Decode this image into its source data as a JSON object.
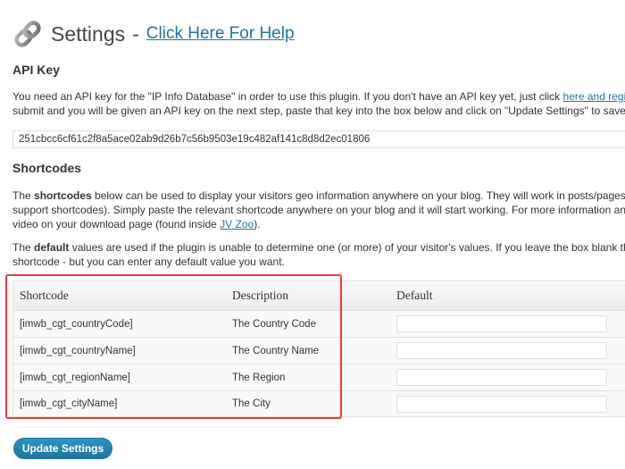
{
  "header": {
    "title": "Settings",
    "separator": "-",
    "help_link": "Click Here For Help"
  },
  "api_key": {
    "heading": "API Key",
    "desc_line1_prefix": "You need an API key for the \"IP Info Database\" in order to use this plugin. If you don't have an API key yet, just click ",
    "desc_link": "here and register",
    "desc_line2": "submit and you will be given an API key on the next step, paste that key into the box below and click on \"Update Settings\" to save it.",
    "value": "251cbcc6cf61c2f8a5ace02ab9d26b7c56b9503e19c482af141c8d8d2ec01806"
  },
  "shortcodes": {
    "heading": "Shortcodes",
    "para1_line1_prefix": "The ",
    "para1_bold": "shortcodes",
    "para1_line1_rest": " below can be used to display your visitors geo information anywhere on your blog. They will work in posts/pages, in ti",
    "para1_line2": "support shortcodes). Simply paste the relevant shortcode anywhere on your blog and it will start working. For more information and tips",
    "para1_line3_prefix": "video on your download page (found inside ",
    "para1_link": "JV Zoo",
    "para1_line3_suffix": ").",
    "para2_line1_prefix": "The ",
    "para2_bold": "default",
    "para2_line1_rest": " values are used if the plugin is unable to determine one (or more) of your visitor's values. If you leave the box blank the plu",
    "para2_line2": "shortcode - but you can enter any default value you want."
  },
  "table": {
    "headers": [
      "Shortcode",
      "Description",
      "Default"
    ],
    "rows": [
      {
        "shortcode": "[imwb_cgt_countryCode]",
        "description": "The Country Code",
        "default": ""
      },
      {
        "shortcode": "[imwb_cgt_countryName]",
        "description": "The Country Name",
        "default": ""
      },
      {
        "shortcode": "[imwb_cgt_regionName]",
        "description": "The Region",
        "default": ""
      },
      {
        "shortcode": "[imwb_cgt_cityName]",
        "description": "The City",
        "default": ""
      }
    ]
  },
  "update_button": "Update Settings",
  "colors": {
    "link": "#21759b",
    "highlight_border": "#e64037",
    "button": "#21759b"
  },
  "icons": {
    "header_icon": "link-chain-icon"
  }
}
